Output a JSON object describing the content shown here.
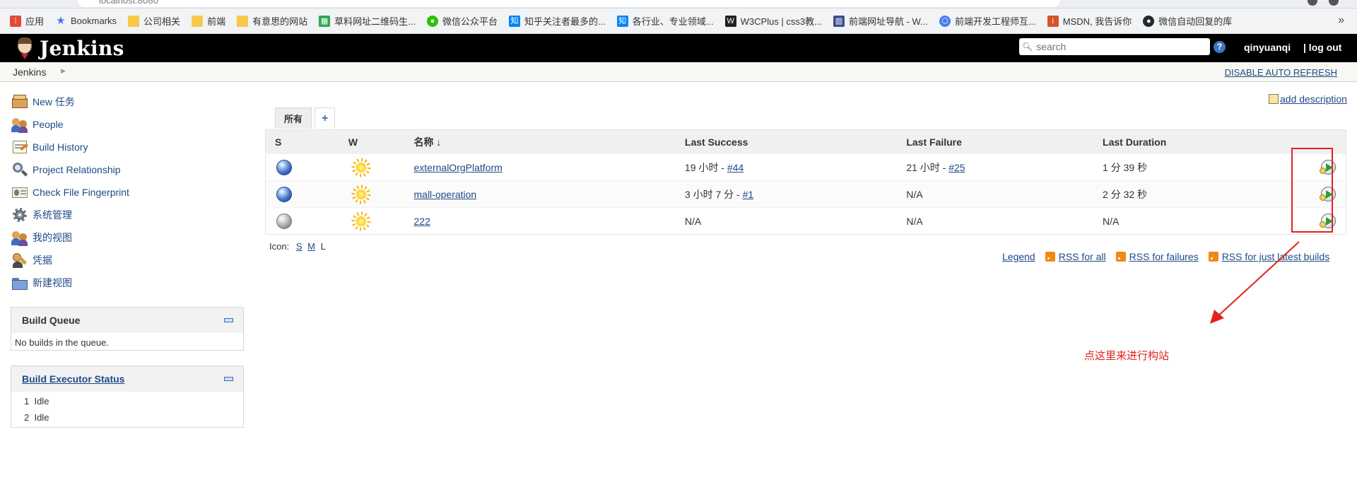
{
  "browser": {
    "url": "localhost:8080",
    "more_label": "»",
    "bookmarks": [
      {
        "label": "应用",
        "icon": "apps-grid-icon",
        "color": "#e14a3a"
      },
      {
        "label": "Bookmarks",
        "icon": "star-icon",
        "color": "#3b78e7"
      },
      {
        "label": "公司相关",
        "icon": "folder-icon",
        "color": "#f7c948"
      },
      {
        "label": "前端",
        "icon": "folder-icon",
        "color": "#f7c948"
      },
      {
        "label": "有意思的网站",
        "icon": "folder-icon",
        "color": "#f7c948"
      },
      {
        "label": "草料网址二维码生...",
        "icon": "qrcode-icon",
        "color": "#2fa84f"
      },
      {
        "label": "微信公众平台",
        "icon": "wechat-icon",
        "color": "#2dc100"
      },
      {
        "label": "知乎关注者最多的...",
        "icon": "zhihu-icon",
        "color": "#0084ff"
      },
      {
        "label": "各行业、专业领域...",
        "icon": "zhihu-icon",
        "color": "#0084ff"
      },
      {
        "label": "W3CPlus | css3教...",
        "icon": "w3cplus-icon",
        "color": "#222222"
      },
      {
        "label": "前端网址导航 - W...",
        "icon": "grid-icon",
        "color": "#3d4f8c"
      },
      {
        "label": "前端开发工程师互...",
        "icon": "hexagon-icon",
        "color": "#4a7bea"
      },
      {
        "label": "MSDN, 我告诉你",
        "icon": "msdn-icon",
        "color": "#d9532c"
      },
      {
        "label": "微信自动回复的库",
        "icon": "github-icon",
        "color": "#24292e"
      }
    ]
  },
  "header": {
    "title": "Jenkins",
    "search_placeholder": "search",
    "help_label": "?",
    "user": "qinyuanqi",
    "logout": "| log out"
  },
  "breadcrumb": {
    "root": "Jenkins",
    "disable_refresh": "DISABLE AUTO REFRESH"
  },
  "tasks": [
    {
      "label": "New 任务",
      "icon": "new-item-icon"
    },
    {
      "label": "People",
      "icon": "people-icon"
    },
    {
      "label": "Build History",
      "icon": "build-history-icon"
    },
    {
      "label": "Project Relationship",
      "icon": "search-icon"
    },
    {
      "label": "Check File Fingerprint",
      "icon": "fingerprint-icon"
    },
    {
      "label": "系统管理",
      "icon": "gear-icon"
    },
    {
      "label": "我的视图",
      "icon": "people-icon"
    },
    {
      "label": "凭据",
      "icon": "credentials-icon"
    },
    {
      "label": "新建视图",
      "icon": "folder-icon"
    }
  ],
  "build_queue": {
    "title": "Build Queue",
    "empty": "No builds in the queue."
  },
  "executors": {
    "title": "Build Executor Status",
    "rows": [
      {
        "num": "1",
        "status": "Idle"
      },
      {
        "num": "2",
        "status": "Idle"
      }
    ]
  },
  "main": {
    "add_description": "add description",
    "tabs": [
      {
        "label": "所有"
      },
      {
        "label": "+"
      }
    ],
    "columns": {
      "s": "S",
      "w": "W",
      "name": "名称",
      "sort_arrow": "↓",
      "last_success": "Last Success",
      "last_failure": "Last Failure",
      "last_duration": "Last Duration"
    },
    "jobs": [
      {
        "status": "blue",
        "weather": "sunny",
        "name": "externalOrgPlatform",
        "last_success_time": "19 小时 - ",
        "last_success_link": "#44",
        "last_failure_time": "21 小时 - ",
        "last_failure_link": "#25",
        "last_duration": "1 分 39 秒"
      },
      {
        "status": "blue",
        "weather": "sunny",
        "name": "mall-operation",
        "last_success_time": "3 小时 7 分 - ",
        "last_success_link": "#1",
        "last_failure_time": "N/A",
        "last_failure_link": "",
        "last_duration": "2 分 32 秒"
      },
      {
        "status": "grey",
        "weather": "sunny",
        "name": "222",
        "last_success_time": "N/A",
        "last_success_link": "",
        "last_failure_time": "N/A",
        "last_failure_link": "",
        "last_duration": "N/A"
      }
    ],
    "icon_size": {
      "label": "Icon:",
      "s": "S",
      "m": "M",
      "l": "L"
    },
    "legend": "Legend",
    "rss_all": "RSS for all",
    "rss_failures": "RSS for failures",
    "rss_latest": "RSS for just latest builds"
  },
  "annotation": {
    "text": "点这里来进行构站",
    "color": "#e1231b"
  }
}
